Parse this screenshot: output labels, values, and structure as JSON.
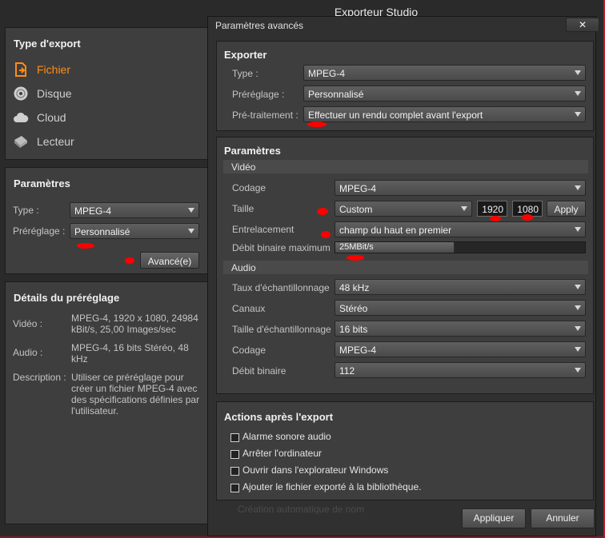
{
  "window": {
    "title": "Exporteur Studio"
  },
  "left": {
    "export_type": {
      "heading": "Type d'export",
      "items": [
        {
          "label": "Fichier",
          "icon": "file-export-icon",
          "active": true
        },
        {
          "label": "Disque",
          "icon": "disc-icon",
          "active": false
        },
        {
          "label": "Cloud",
          "icon": "cloud-icon",
          "active": false
        },
        {
          "label": "Lecteur",
          "icon": "device-icon",
          "active": false
        }
      ]
    },
    "params": {
      "heading": "Paramètres",
      "type_label": "Type :",
      "type_value": "MPEG-4",
      "preset_label": "Préréglage :",
      "preset_value": "Personnalisé",
      "advanced_button": "Avancé(e)"
    },
    "details": {
      "heading": "Détails du préréglage",
      "video_label": "Vidéo :",
      "video_value": "MPEG-4, 1920 x 1080, 24984 kBit/s, 25,00 Images/sec",
      "audio_label": "Audio :",
      "audio_value": "MPEG-4, 16 bits Stéréo, 48 kHz",
      "desc_label": "Description :",
      "desc_value": "Utiliser ce préréglage pour créer un fichier MPEG-4 avec des spécifications définies par l'utilisateur."
    }
  },
  "dialog": {
    "title": "Paramètres avancés",
    "close_label": "✕",
    "exporter": {
      "heading": "Exporter",
      "type_label": "Type :",
      "type_value": "MPEG-4",
      "preset_label": "Préréglage :",
      "preset_value": "Personnalisé",
      "pre_label": "Pré-traitement :",
      "pre_value": "Effectuer un rendu complet avant l'export"
    },
    "settings": {
      "heading": "Paramètres",
      "video": {
        "heading": "Vidéo",
        "codec_label": "Codage",
        "codec_value": "MPEG-4",
        "size_label": "Taille",
        "size_value": "Custom",
        "width": "1920",
        "height": "1080",
        "apply_label": "Apply",
        "interlace_label": "Entrelacement",
        "interlace_value": "champ du haut en premier",
        "bitrate_label": "Débit binaire maximum",
        "bitrate_value": "25MBit/s",
        "bitrate_fill": 0.48
      },
      "audio": {
        "heading": "Audio",
        "rate_label": "Taux d'échantillonnage",
        "rate_value": "48 kHz",
        "channels_label": "Canaux",
        "channels_value": "Stéréo",
        "sample_label": "Taille d'échantillonnage",
        "sample_value": "16 bits",
        "codec_label": "Codage",
        "codec_value": "MPEG-4",
        "bitrate_label": "Débit binaire",
        "bitrate_value": "112"
      }
    },
    "post": {
      "heading": "Actions après l'export",
      "options": [
        "Alarme sonore audio",
        "Arrêter l'ordinateur",
        "Ouvrir dans l'explorateur Windows",
        "Ajouter le fichier exporté à la bibliothèque."
      ],
      "ghost_text": "Création automatique de nom"
    },
    "apply_button": "Appliquer",
    "cancel_button": "Annuler"
  },
  "colors": {
    "accent": "#ff8c1a",
    "annotation": "#ff0000",
    "background": "#2a2a2a"
  }
}
